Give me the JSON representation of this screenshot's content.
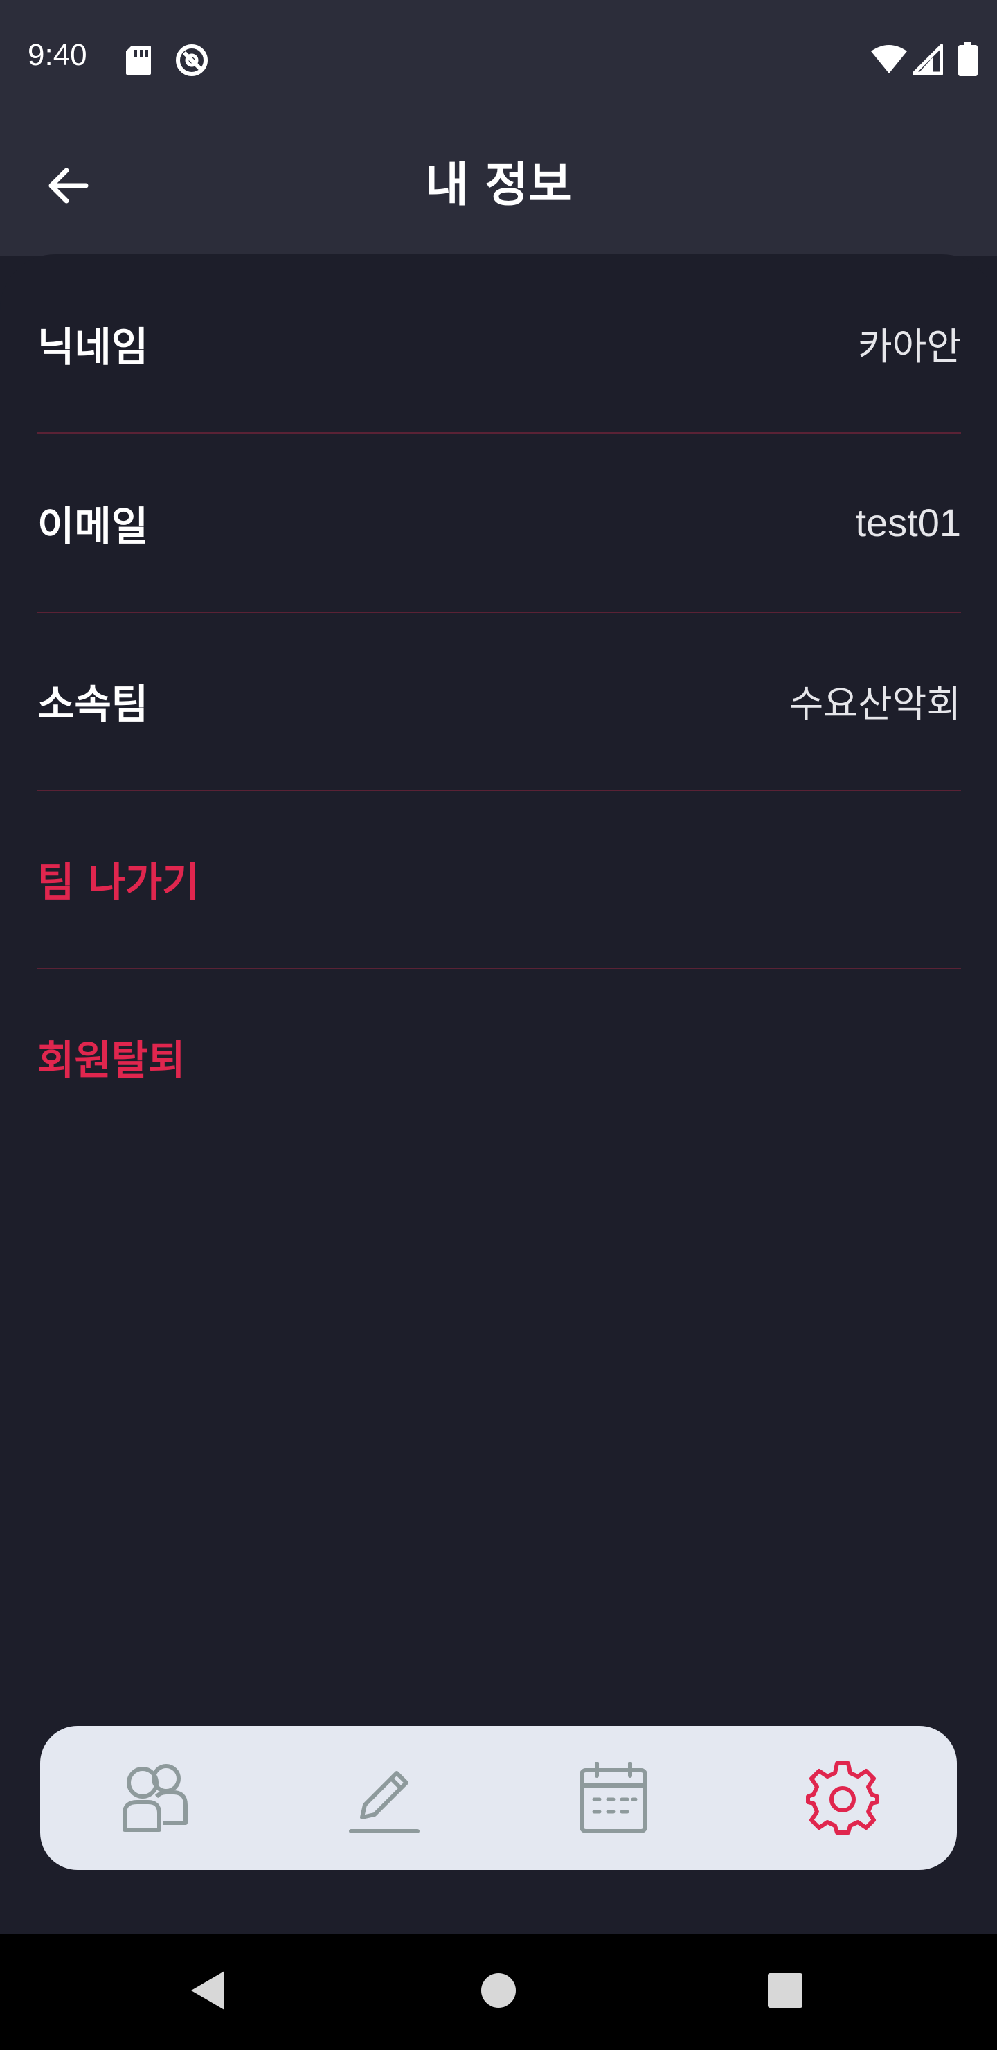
{
  "status_bar": {
    "time": "9:40",
    "icons": [
      "sd-card-icon",
      "at-sign-icon",
      "wifi-icon",
      "signal-icon",
      "battery-icon"
    ]
  },
  "app_bar": {
    "title": "내 정보",
    "back_icon": "arrow-left-icon"
  },
  "profile": {
    "nickname": {
      "label": "닉네임",
      "value": "카아안"
    },
    "email": {
      "label": "이메일",
      "value": "test01"
    },
    "team": {
      "label": "소속팀",
      "value": "수요산악회"
    }
  },
  "actions": {
    "leave_team": "팀 나가기",
    "withdraw": "회원탈퇴"
  },
  "bottom_nav": {
    "items": [
      {
        "icon": "group-icon",
        "active": false
      },
      {
        "icon": "pencil-icon",
        "active": false
      },
      {
        "icon": "calendar-icon",
        "active": false
      },
      {
        "icon": "gear-icon",
        "active": true
      }
    ]
  },
  "colors": {
    "background": "#1D1E2A",
    "header": "#2C2D3A",
    "accent": "#E0264E",
    "divider": "#5A2235",
    "nav_background": "#E4E8F1",
    "nav_icon": "#8E9A9C"
  },
  "system_nav": {
    "icons": [
      "back-triangle-icon",
      "home-circle-icon",
      "recents-square-icon"
    ]
  }
}
